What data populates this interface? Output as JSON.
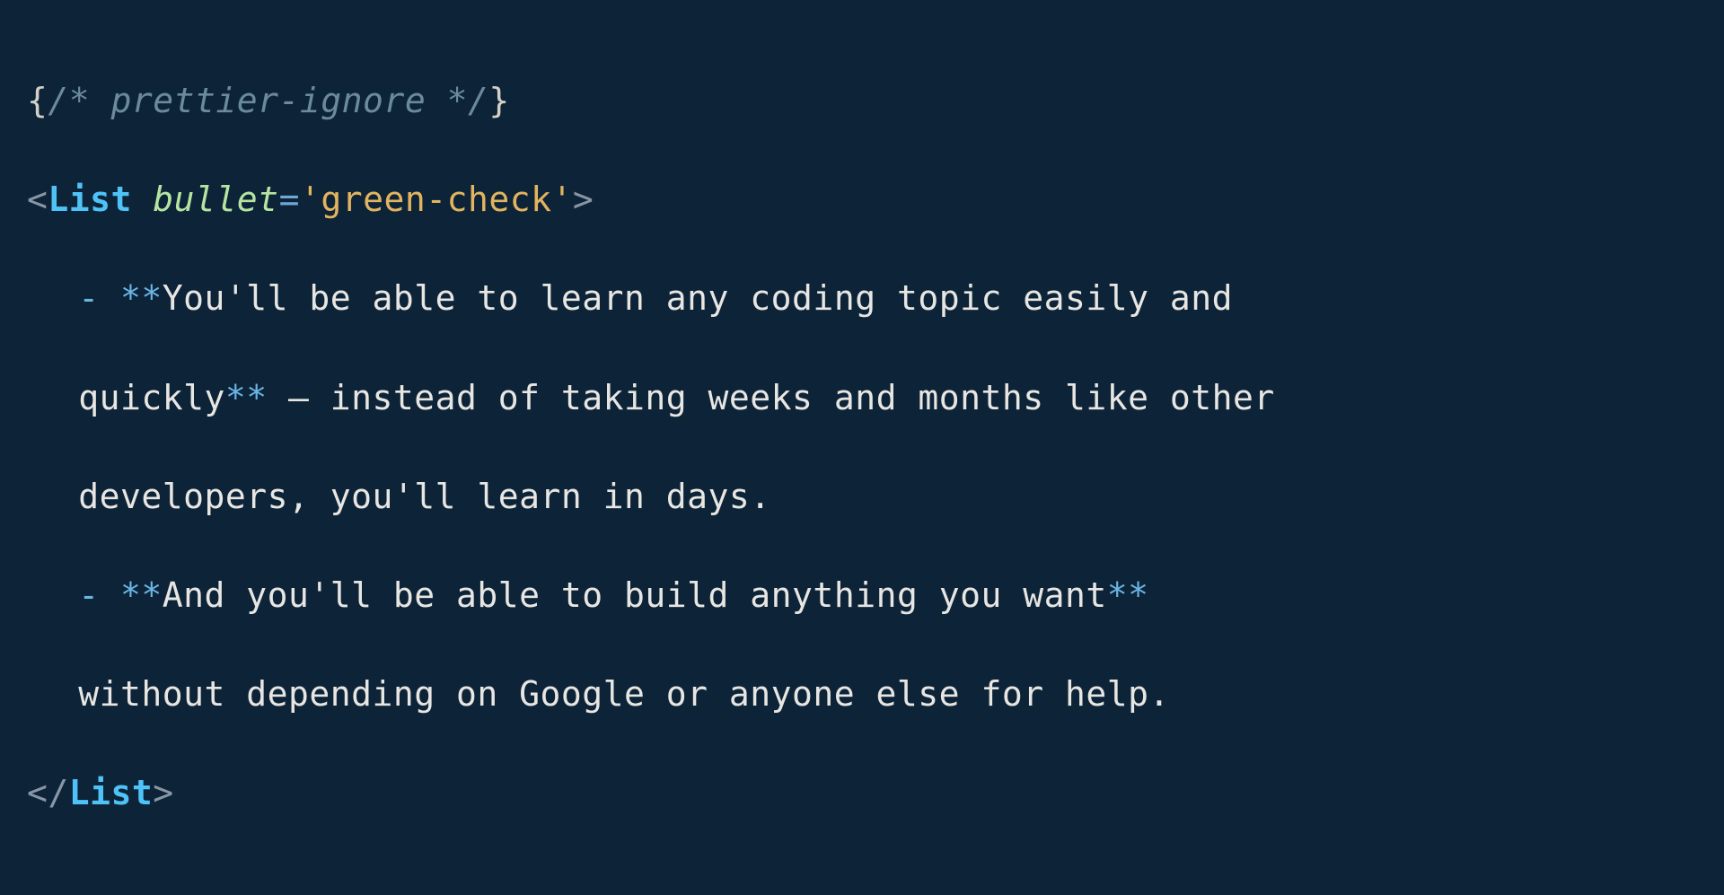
{
  "code": {
    "line1": {
      "brace_open": "{",
      "comment": "/* prettier-ignore */",
      "brace_close": "}"
    },
    "line2": {
      "angle_open": "<",
      "tag": "List",
      "space": " ",
      "attr": "bullet",
      "equals": "=",
      "string": "'green-check'",
      "angle_close": ">"
    },
    "line3": {
      "dash": "- ",
      "bold_open": "**",
      "bold_text": "You'll be able to learn any coding topic easily and"
    },
    "line4": {
      "bold_text": "quickly",
      "bold_close": "**",
      "rest": " — instead of taking weeks and months like other"
    },
    "line5": {
      "text": "developers, you'll learn in days."
    },
    "line6": {
      "dash": "- ",
      "bold_open": "**",
      "bold_text": "And you'll be able to build anything you want",
      "bold_close": "**"
    },
    "line7": {
      "text": "without depending on Google or anyone else for help."
    },
    "line8": {
      "angle_open": "<",
      "slash": "/",
      "tag": "List",
      "angle_close": ">"
    }
  }
}
